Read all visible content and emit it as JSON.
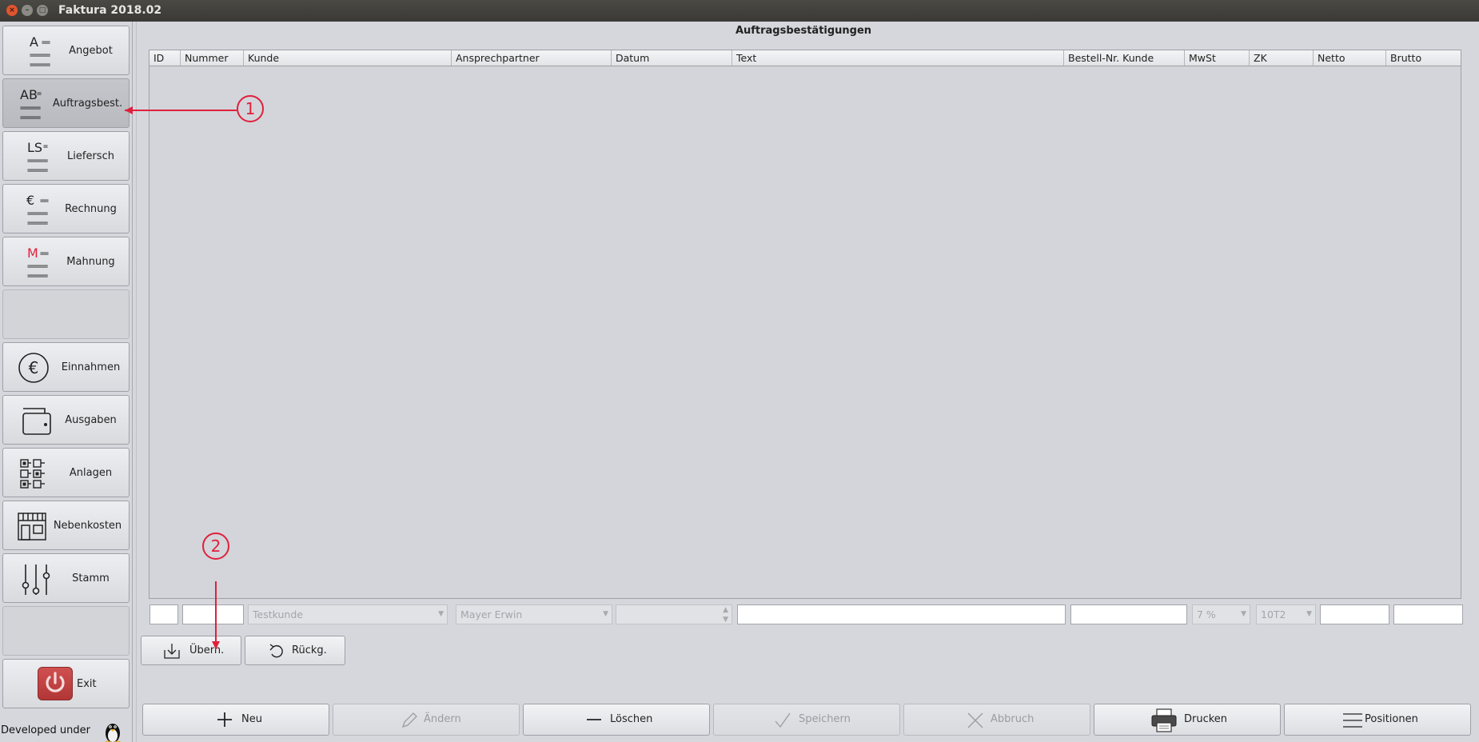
{
  "window": {
    "title": "Faktura 2018.02"
  },
  "sidebar": {
    "items": [
      {
        "label": "Angebot",
        "icon_letter": "A"
      },
      {
        "label": "Auftragsbest.",
        "icon_letter": "AB"
      },
      {
        "label": "Liefersch",
        "icon_letter": "LS"
      },
      {
        "label": "Rechnung",
        "icon_letter": "€"
      },
      {
        "label": "Mahnung",
        "icon_letter": "M"
      },
      {
        "label": "Einnahmen",
        "icon": "euro-circle-icon"
      },
      {
        "label": "Ausgaben",
        "icon": "wallet-icon"
      },
      {
        "label": "Anlagen",
        "icon": "checklist-icon"
      },
      {
        "label": "Nebenkosten",
        "icon": "building-icon"
      },
      {
        "label": "Stamm",
        "icon": "sliders-icon"
      },
      {
        "label": "Exit",
        "icon": "power-icon"
      }
    ],
    "developed_under": "Developed under",
    "mahnung_color": "#e0203c"
  },
  "main": {
    "title": "Auftragsbestätigungen",
    "columns": [
      "ID",
      "Nummer",
      "Kunde",
      "Ansprechpartner",
      "Datum",
      "Text",
      "Bestell-Nr. Kunde",
      "MwSt",
      "ZK",
      "Netto",
      "Brutto"
    ],
    "edit_row": {
      "kunde": "Testkunde",
      "ansprechpartner": "Mayer Erwin",
      "mwst": "7 %",
      "zk": "10T2"
    },
    "uebern_label": "Übern.",
    "rueckg_label": "Rückg."
  },
  "toolbar": {
    "neu": "Neu",
    "aendern": "Ändern",
    "loeschen": "Löschen",
    "speichern": "Speichern",
    "abbruch": "Abbruch",
    "drucken": "Drucken",
    "positionen": "Positionen"
  },
  "annotations": {
    "first": "1",
    "second": "2",
    "color": "#e0203c"
  }
}
